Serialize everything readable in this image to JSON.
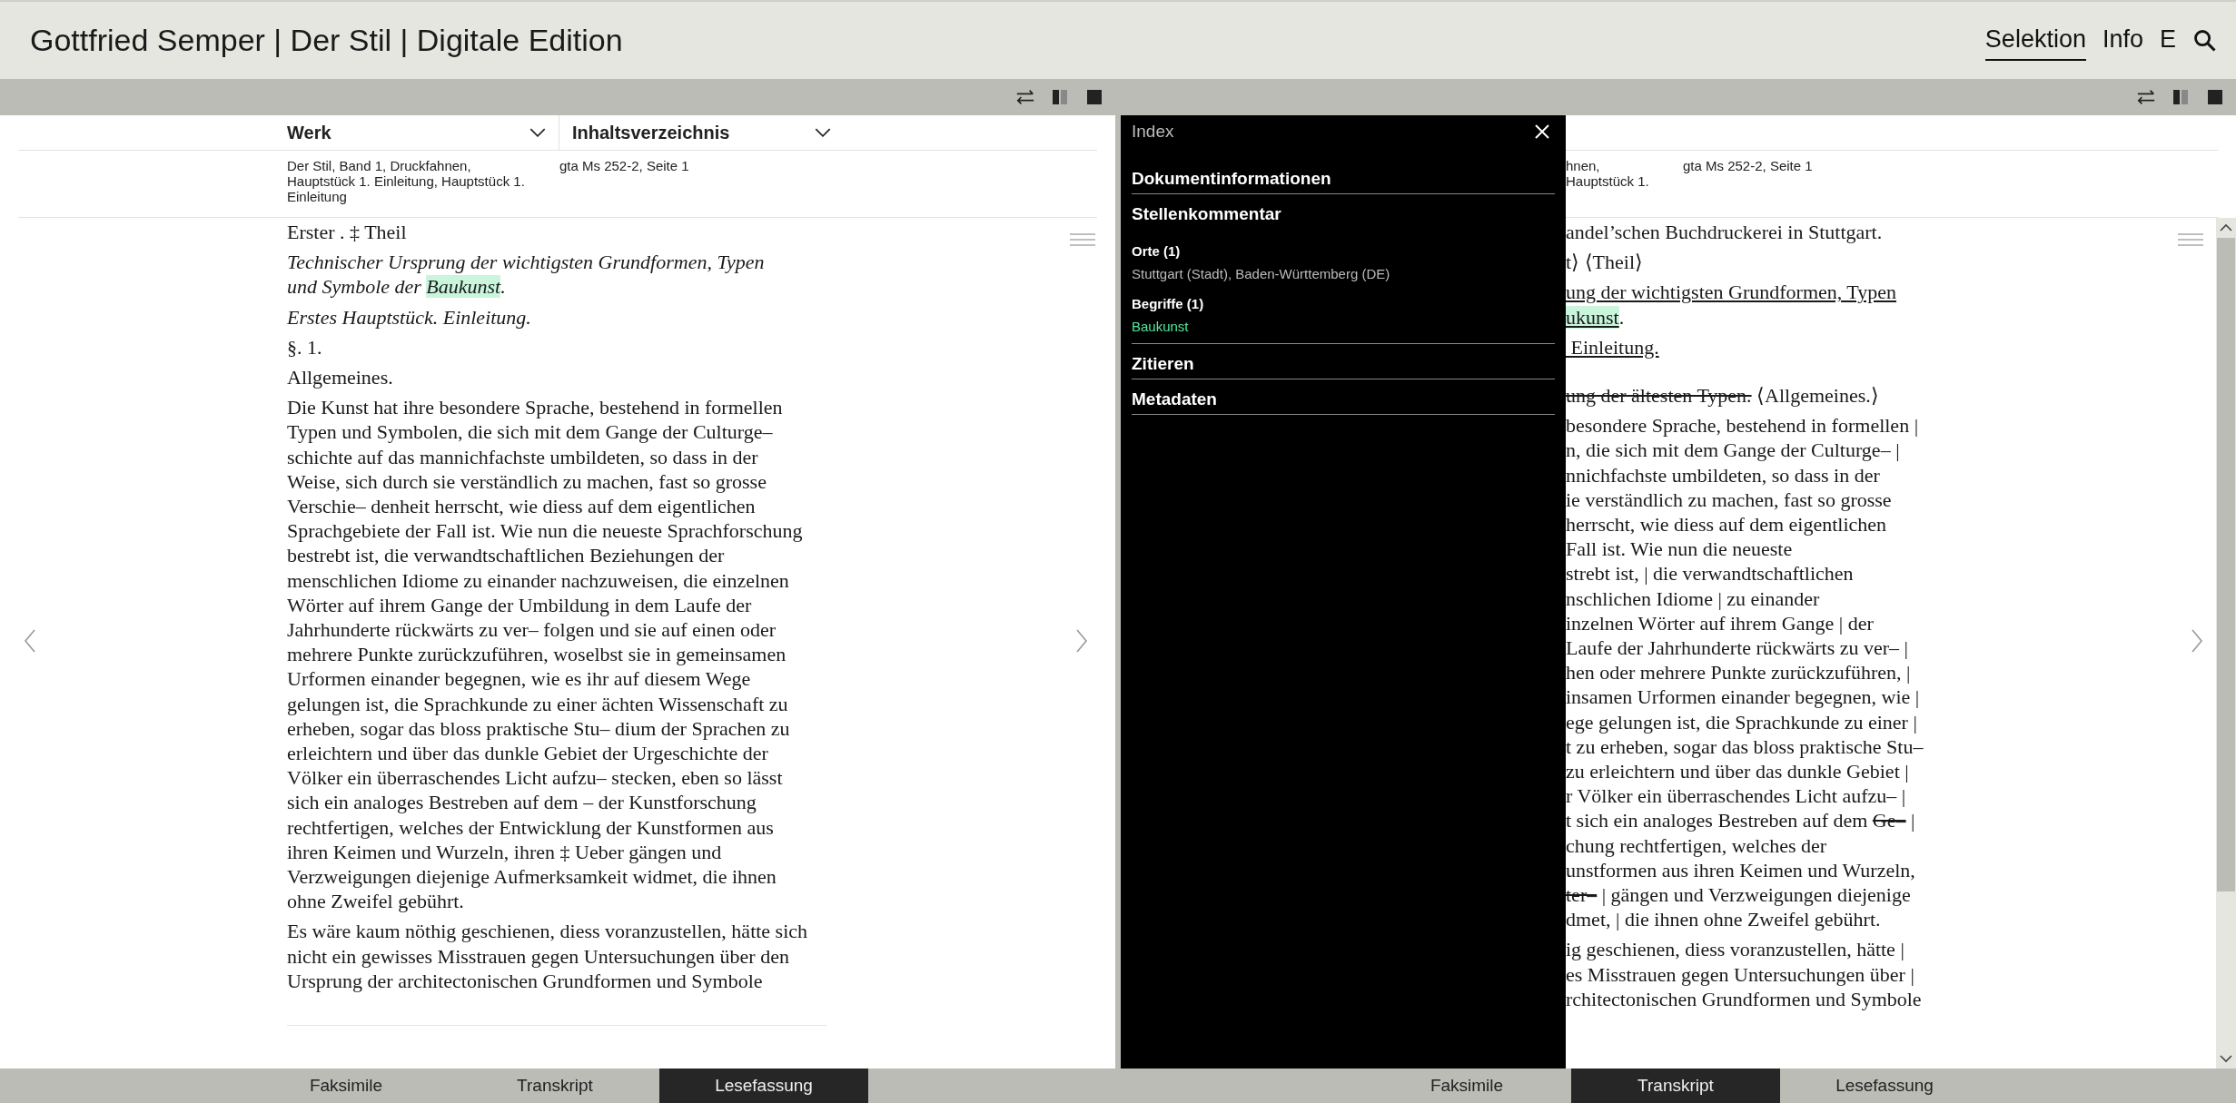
{
  "header": {
    "title": "Gottfried Semper | Der Stil | Digitale Edition",
    "nav": [
      {
        "label": "Selektion",
        "selected": true
      },
      {
        "label": "Info",
        "selected": false
      },
      {
        "label": "E",
        "selected": false
      }
    ]
  },
  "left_panel": {
    "columns": [
      {
        "label": "Werk"
      },
      {
        "label": "Inhaltsverzeichnis"
      }
    ],
    "info": [
      [
        "Der Stil, Band 1, Druckfahnen,",
        "Hauptstück 1. Einleitung, Hauptstück 1.",
        "Einleitung"
      ],
      [
        "gta Ms 252-2, Seite 1"
      ]
    ],
    "blocks": [
      {
        "kind": "plain",
        "lines": [
          "Erster . ‡ Theil"
        ]
      },
      {
        "kind": "italic",
        "lines": [
          "Technischer Ursprung der wichtigsten Grundformen, Typen",
          [
            {
              "text": "und Symbole der ",
              "kind": "plain"
            },
            {
              "text": "Baukunst",
              "kind": "highlight"
            },
            {
              "text": ".",
              "kind": "plain"
            }
          ]
        ]
      },
      {
        "kind": "italic",
        "lines": [
          "Erstes Hauptstück. Einleitung."
        ]
      },
      {
        "kind": "plain",
        "lines": [
          "§. 1."
        ]
      },
      {
        "kind": "plain",
        "lines": [
          "Allgemeines."
        ]
      },
      {
        "kind": "plain",
        "lines": [
          "Die Kunst hat ihre besondere Sprache, bestehend in formellen",
          "Typen und Symbolen, die sich mit dem Gange der Culturge–",
          "schichte auf das mannichfachste umbildeten, so dass in der",
          "Weise, sich durch sie verständlich zu machen, fast so grosse",
          "Verschie– denheit herrscht, wie diess auf dem eigentlichen",
          "Sprachgebiete der Fall ist. Wie nun die neueste Sprachforschung",
          "bestrebt ist, die verwandtschaftlichen Beziehungen der",
          "menschlichen Idiome zu einander nachzuweisen, die einzelnen",
          "Wörter auf ihrem Gange der Umbildung in dem Laufe der",
          "Jahrhunderte rückwärts zu ver– folgen und sie auf einen oder",
          "mehrere Punkte zurückzuführen, woselbst sie in gemeinsamen",
          "Urformen einander begegnen, wie es ihr auf diesem Wege",
          "gelungen ist, die Sprachkunde zu einer ächten Wissenschaft zu",
          "erheben, sogar das bloss praktische Stu– dium der Sprachen zu",
          "erleichtern und über das dunkle Gebiet der Urgeschichte der",
          "Völker ein überraschendes Licht aufzu– stecken, eben so lässt",
          "sich ein analoges Bestreben auf dem – der Kunstforschung",
          "rechtfertigen, welches der Entwicklung der Kunstformen aus",
          "ihren Keimen und Wurzeln, ihren ‡ Ueber gängen und",
          "Verzweigungen diejenige Aufmerksamkeit widmet, die ihnen",
          "ohne Zweifel gebührt."
        ]
      },
      {
        "kind": "plain",
        "lines": [
          "Es wäre kaum nöthig geschienen, diess voranzustellen, hätte sich",
          "nicht ein gewisses Misstrauen gegen Untersuchungen über den",
          "Ursprung der architectonischen Grundformen und Symbole"
        ]
      }
    ],
    "tabs": [
      {
        "label": "Faksimile",
        "selected": false
      },
      {
        "label": "Transkript",
        "selected": false
      },
      {
        "label": "Lesefassung",
        "selected": true
      }
    ]
  },
  "right_panel": {
    "info": [
      [
        "hnen,",
        "Hauptstück 1."
      ],
      [
        "gta Ms 252-2, Seite 1"
      ]
    ],
    "blocks": [
      {
        "kind": "plain",
        "lines": [
          "andel’schen Buchdruckerei in Stuttgart."
        ]
      },
      {
        "kind": "plain",
        "lines": [
          "t⟩ ⟨Theil⟩"
        ]
      },
      {
        "kind": "plain",
        "lines": [
          [
            {
              "text": "ung der wichtigsten Grundformen, Typen",
              "kind": "underline"
            }
          ],
          [
            {
              "text": "ukunst",
              "kind": "underline-highlight"
            },
            {
              "text": ".",
              "kind": "plain"
            }
          ]
        ]
      },
      {
        "kind": "plain",
        "lines": [
          [
            {
              "text": " Einleitung.",
              "kind": "underline"
            }
          ]
        ]
      },
      {
        "kind": "section",
        "lines": [
          [
            {
              "text": "ung der ältesten Typen.",
              "kind": "strike"
            },
            {
              "text": " ⟨Allgemeines.⟩",
              "kind": "plain"
            }
          ]
        ]
      },
      {
        "kind": "plain",
        "lines": [
          "besondere Sprache, bestehend in formellen |",
          "n, die sich mit dem Gange der Culturge– |",
          "nnichfachste umbildeten, so dass in der",
          "ie verständlich zu machen, fast so grosse",
          "herrscht, wie diess auf dem eigentlichen",
          "Fall ist. Wie nun die neueste",
          "strebt ist, | die verwandtschaftlichen",
          "nschlichen Idiome | zu einander",
          "inzelnen Wörter auf ihrem Gange | der",
          "Laufe der Jahrhunderte rückwärts zu ver– |",
          "hen oder mehrere Punkte zurückzuführen, |",
          "insamen Urformen einander begegnen, wie |",
          "ege gelungen ist, die Sprachkunde zu einer |",
          "t zu erheben, sogar das bloss praktische Stu–",
          "zu erleichtern und über das dunkle Gebiet |",
          "r Völker ein überraschendes Licht aufzu– |",
          [
            {
              "text": "t sich ein analoges Bestreben auf dem ",
              "kind": "plain"
            },
            {
              "text": "Ge–",
              "kind": "strike"
            },
            {
              "text": " |",
              "kind": "plain"
            }
          ],
          "chung rechtfertigen, welches der",
          "unstformen aus ihren Keimen und Wurzeln,",
          [
            {
              "text": "ter–",
              "kind": "strike"
            },
            {
              "text": " | gängen und Verzweigungen diejenige",
              "kind": "plain"
            }
          ],
          "dmet, | die ihnen ohne Zweifel gebührt."
        ]
      },
      {
        "kind": "plain",
        "lines": [
          "ig geschienen, diess voranzustellen, hätte |",
          "es Misstrauen gegen Untersuchungen über |",
          "rchitectonischen Grundformen und Symbole"
        ]
      }
    ],
    "tabs": [
      {
        "label": "Faksimile",
        "selected": false
      },
      {
        "label": "Transkript",
        "selected": true
      },
      {
        "label": "Lesefassung",
        "selected": false
      }
    ],
    "index": {
      "title": "Index",
      "sections": [
        {
          "kind": "heading",
          "label": "Dokumentinformationen"
        },
        {
          "kind": "heading",
          "label": "Stellenkommentar",
          "groups": [
            {
              "label": "Orte (1)",
              "items": [
                {
                  "text": "Stuttgart (Stadt), Baden-Württemberg (DE)",
                  "kind": "place"
                }
              ]
            },
            {
              "label": "Begriffe (1)",
              "items": [
                {
                  "text": "Baukunst",
                  "kind": "term"
                }
              ]
            }
          ]
        },
        {
          "kind": "heading",
          "label": "Zitieren"
        },
        {
          "kind": "heading",
          "label": "Metadaten"
        }
      ]
    }
  }
}
